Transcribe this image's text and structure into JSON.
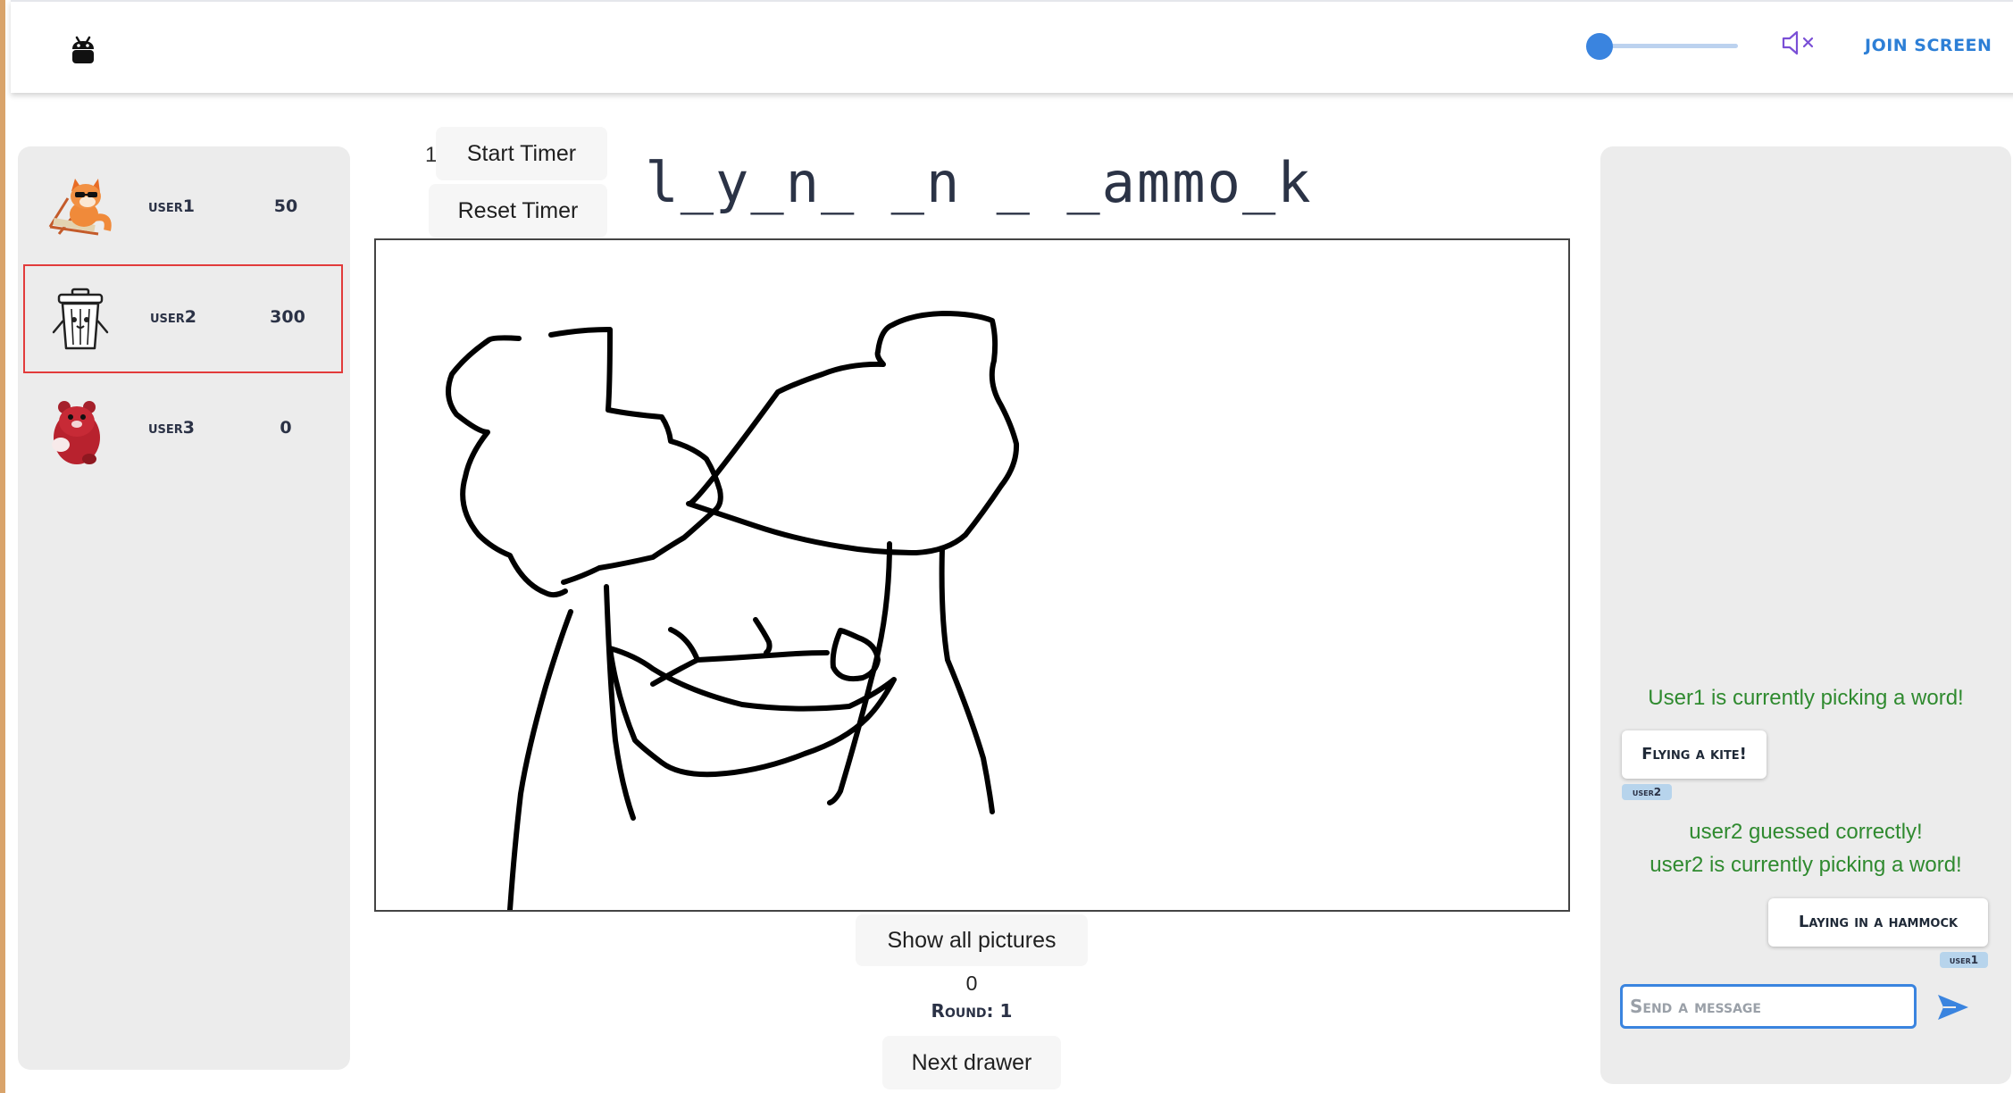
{
  "header": {
    "join_label": "JOIN SCREEN",
    "volume_level": 0.0
  },
  "players": [
    {
      "name": "user1",
      "score": "50",
      "avatar": "fox-sunglasses-avatar"
    },
    {
      "name": "user2",
      "score": "300",
      "avatar": "trash-can-avatar"
    },
    {
      "name": "user3",
      "score": "0",
      "avatar": "red-bear-avatar"
    }
  ],
  "timer": {
    "value": "1",
    "start_label": "Start Timer",
    "reset_label": "Reset Timer"
  },
  "word_hint": "l_y_n_ _n _ _ammo_k",
  "controls": {
    "show_label": "Show all pictures",
    "counter": "0",
    "round_label": "Round: 1",
    "next_label": "Next drawer"
  },
  "chat": {
    "messages": [
      {
        "type": "system",
        "text": "User1 is currently picking a word!"
      },
      {
        "type": "bubble",
        "text": "Flying a kite!",
        "user": "user2"
      },
      {
        "type": "system",
        "text": "user2 guessed correctly!"
      },
      {
        "type": "system",
        "text": "user2 is currently picking a word!"
      },
      {
        "type": "bubble",
        "text": "Laying in a hammock",
        "user": "user1"
      }
    ],
    "placeholder": "Send a message"
  },
  "colors": {
    "accent": "#3a84df",
    "system_text": "#2f8a2f",
    "active_border": "#e23b3b"
  }
}
